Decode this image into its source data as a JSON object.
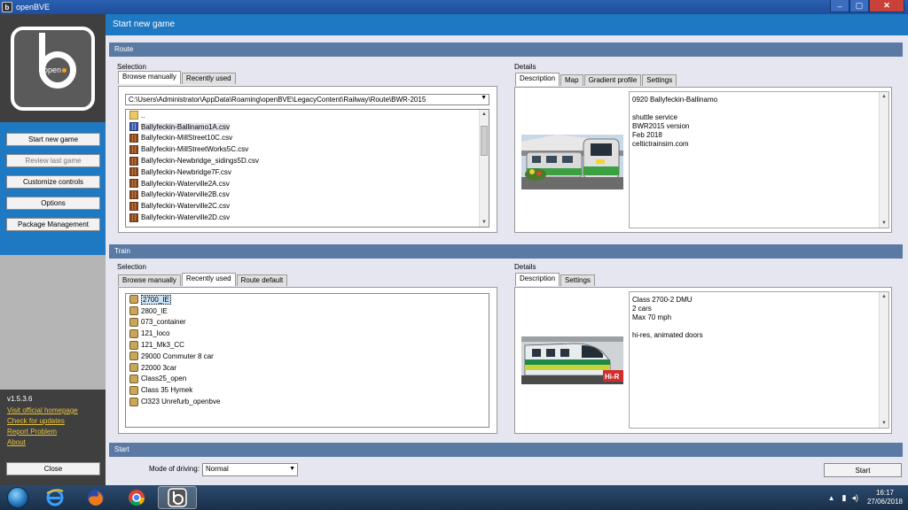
{
  "window": {
    "title": "openBVE"
  },
  "sidebar": {
    "logo_text": "open",
    "nav": [
      {
        "label": "Start new game",
        "disabled": false
      },
      {
        "label": "Review last game",
        "disabled": true
      },
      {
        "label": "Customize controls",
        "disabled": false
      },
      {
        "label": "Options",
        "disabled": false
      },
      {
        "label": "Package Management",
        "disabled": false
      }
    ],
    "version": "v1.5.3.6",
    "links": [
      "Visit official homepage",
      "Check for updates",
      "Report Problem",
      "About"
    ],
    "close_label": "Close"
  },
  "header": {
    "title": "Start new game"
  },
  "route": {
    "section_title": "Route",
    "selection_label": "Selection",
    "tabs": [
      "Browse manually",
      "Recently used"
    ],
    "path": "C:\\Users\\Administrator\\AppData\\Roaming\\openBVE\\LegacyContent\\Railway\\Route\\BWR-2015",
    "files": [
      "..",
      "Ballyfeckin-Ballinamo1A.csv",
      "Ballyfeckin-MillStreet10C.csv",
      "Ballyfeckin-MillStreetWorks5C.csv",
      "Ballyfeckin-Newbridge_sidings5D.csv",
      "Ballyfeckin-Newbridge7F.csv",
      "Ballyfeckin-Waterville2A.csv",
      "Ballyfeckin-Waterville2B.csv",
      "Ballyfeckin-Waterville2C.csv",
      "Ballyfeckin-Waterville2D.csv"
    ],
    "details_label": "Details",
    "detail_tabs": [
      "Description",
      "Map",
      "Gradient profile",
      "Settings"
    ],
    "description": [
      "0920 Ballyfeckin-Ballinamo",
      "",
      "shuttle service",
      "BWR2015 version",
      "Feb 2018",
      "celtictrainsim.com"
    ]
  },
  "train": {
    "section_title": "Train",
    "selection_label": "Selection",
    "tabs": [
      "Browse manually",
      "Recently used",
      "Route default"
    ],
    "items": [
      "2700_IE",
      "2800_IE",
      "073_container",
      "121_loco",
      "121_Mk3_CC",
      "29000 Commuter 8 car",
      "22000 3car",
      "Class25_open",
      "Class 35 Hymek",
      "Cl323 Unrefurb_openbve"
    ],
    "details_label": "Details",
    "detail_tabs": [
      "Description",
      "Settings"
    ],
    "description": [
      "Class 2700-2 DMU",
      "2 cars",
      "Max 70 mph",
      "",
      "hi-res, animated doors"
    ],
    "image_badge": "Hi-R"
  },
  "start": {
    "section_title": "Start",
    "mode_label": "Mode of driving:",
    "mode_value": "Normal",
    "start_label": "Start"
  },
  "taskbar": {
    "time": "16:17",
    "date": "27/06/2018"
  },
  "colors": {
    "accent": "#1f78c2",
    "section": "#5b7aa3",
    "link": "#e9c43a"
  }
}
